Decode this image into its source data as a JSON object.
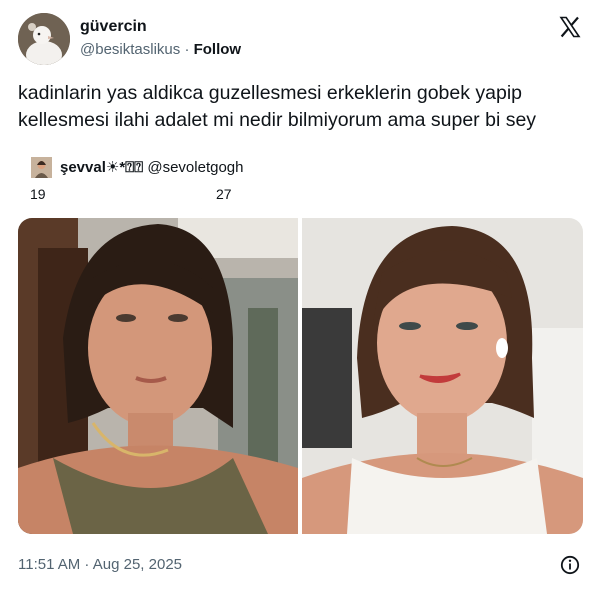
{
  "header": {
    "display_name": "güvercin",
    "handle": "@besiktaslikus",
    "separator": "·",
    "follow_label": "Follow",
    "logo_icon": "x-logo-icon",
    "avatar_icon": "pigeon-avatar"
  },
  "tweet": {
    "text": "kadinlarin yas aldikca guzellesmesi erkeklerin gobek yapip kellesmesi ilahi adalet mi nedir bilmiyorum ama super bi sey"
  },
  "quote": {
    "name": "şevval☀*",
    "name_symbols": "⍰⍰",
    "handle": "@sevoletgogh",
    "left_number": "19",
    "right_number": "27"
  },
  "photos": {
    "left_label": "photo-age-19",
    "right_label": "photo-age-27"
  },
  "footer": {
    "timestamp": "11:51 AM · Aug 25, 2025",
    "info_icon": "info-icon"
  },
  "colors": {
    "text": "#0f1419",
    "secondary": "#536471",
    "background": "#ffffff"
  }
}
